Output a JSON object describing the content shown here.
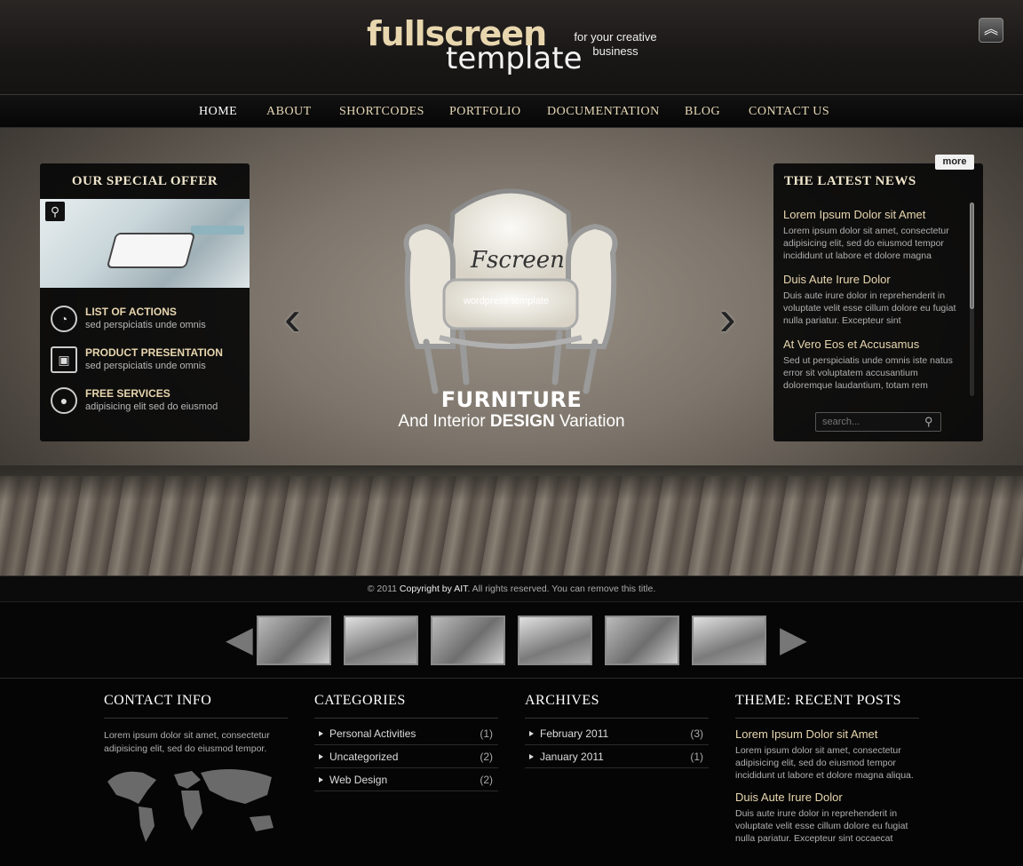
{
  "header": {
    "logo_main": "fullscreen",
    "logo_sub": "template",
    "tagline": "for your creative business",
    "top_button_icon": "double-chevron-up-icon"
  },
  "nav": {
    "items": [
      "HOME",
      "ABOUT",
      "SHORTCODES",
      "PORTFOLIO",
      "DOCUMENTATION",
      "BLOG",
      "CONTACT US"
    ],
    "active": "HOME"
  },
  "offer": {
    "title": "OUR SPECIAL OFFER",
    "items": [
      {
        "title": "LIST OF ACTIONS",
        "sub": "sed perspiciatis unde omnis",
        "icon": "speedometer-icon"
      },
      {
        "title": "PRODUCT PRESENTATION",
        "sub": "sed perspiciatis unde omnis",
        "icon": "suitcase-icon"
      },
      {
        "title": "FREE SERVICES",
        "sub": "adipisicing elit sed do eiusmod",
        "icon": "plate-cutlery-icon"
      }
    ]
  },
  "hero": {
    "chair_logo": "Fscreen",
    "chair_caption": "wordpress template",
    "title": "FURNITURE",
    "sub_pre": "And Interior ",
    "sub_bold": "DESIGN",
    "sub_post": " Variation"
  },
  "news": {
    "title": "THE LATEST NEWS",
    "more": "more",
    "items": [
      {
        "title": "Lorem Ipsum Dolor sit Amet",
        "body": "Lorem ipsum dolor sit amet, consectetur adipisicing elit, sed do eiusmod tempor incididunt ut labore et dolore magna"
      },
      {
        "title": "Duis Aute Irure Dolor",
        "body": "Duis aute irure dolor in reprehenderit in voluptate velit esse cillum dolore eu fugiat nulla pariatur. Excepteur sint"
      },
      {
        "title": "At Vero Eos et Accusamus",
        "body": "Sed ut perspiciatis unde omnis iste natus error sit voluptatem accusantium doloremque laudantium, totam rem"
      }
    ],
    "search_placeholder": "search..."
  },
  "copyright": {
    "pre": "© 2011 ",
    "bold": "Copyright by AIT",
    "post": ". All rights reserved. You can remove this title."
  },
  "footer": {
    "contact": {
      "title": "CONTACT INFO",
      "text": "Lorem ipsum dolor sit amet, consectetur adipisicing elit, sed do eiusmod tempor."
    },
    "categories": {
      "title": "CATEGORIES",
      "items": [
        {
          "label": "Personal Activities",
          "count": "(1)"
        },
        {
          "label": "Uncategorized",
          "count": "(2)"
        },
        {
          "label": "Web Design",
          "count": "(2)"
        }
      ]
    },
    "archives": {
      "title": "ARCHIVES",
      "items": [
        {
          "label": "February 2011",
          "count": "(3)"
        },
        {
          "label": "January 2011",
          "count": "(1)"
        }
      ]
    },
    "recent": {
      "title": "THEME: RECENT POSTS",
      "items": [
        {
          "title": "Lorem Ipsum Dolor sit Amet",
          "body": "Lorem ipsum dolor sit amet, consectetur adipisicing elit, sed do eiusmod tempor incididunt ut labore et dolore magna aliqua."
        },
        {
          "title": "Duis Aute Irure Dolor",
          "body": "Duis aute irure dolor in reprehenderit in voluptate velit esse cillum dolore eu fugiat nulla pariatur. Excepteur sint occaecat"
        }
      ]
    }
  },
  "colors": {
    "accent": "#e8d6ae",
    "background": "#050505"
  }
}
